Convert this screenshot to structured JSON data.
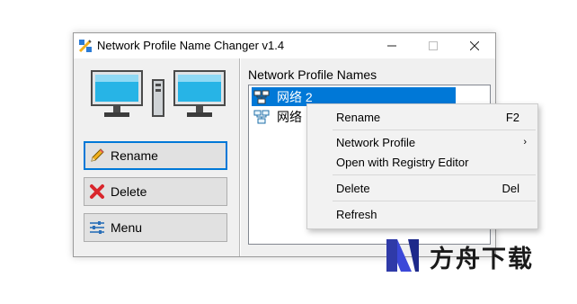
{
  "window": {
    "title": "Network Profile Name Changer v1.4"
  },
  "buttons": {
    "rename": "Rename",
    "delete": "Delete",
    "menu": "Menu"
  },
  "list": {
    "label": "Network Profile Names",
    "items": [
      {
        "name": "网络 2",
        "selected": true
      },
      {
        "name": "网络",
        "selected": false
      }
    ]
  },
  "context_menu": {
    "items": [
      {
        "label": "Rename",
        "shortcut": "F2"
      },
      {
        "label": "Network Profile",
        "submenu": "›"
      },
      {
        "label": "Open with Registry Editor"
      },
      {
        "label": "Delete",
        "shortcut": "Del"
      },
      {
        "label": "Refresh"
      }
    ]
  },
  "watermark": {
    "text": "方舟下载"
  },
  "colors": {
    "selection": "#0078d7",
    "monitor_screen": "#27b4e6",
    "delete_red": "#d9262c"
  }
}
